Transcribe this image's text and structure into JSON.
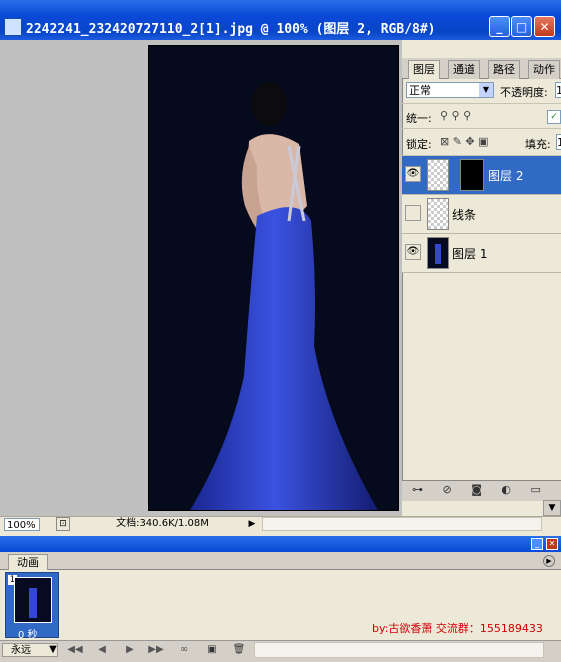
{
  "window": {
    "title": "2242241_232420727110_2[1].jpg @ 100% (图层 2, RGB/8#)",
    "min": "_",
    "max": "□",
    "close": "✕"
  },
  "status": {
    "zoom": "100%",
    "doc": "文档:340.6K/1.08M"
  },
  "layers_panel": {
    "tabs": [
      "图层",
      "通道",
      "路径",
      "动作"
    ],
    "blend_mode": "正常",
    "opacity_label": "不透明度:",
    "opacity_value": "1",
    "unify_label": "统一:",
    "lock_label": "锁定:",
    "fill_label": "填充:",
    "fill_value": "1",
    "layers": [
      {
        "name": "图层 2",
        "visible": true,
        "selected": true
      },
      {
        "name": "线条",
        "visible": false,
        "selected": false
      },
      {
        "name": "图层 1",
        "visible": true,
        "selected": false
      }
    ]
  },
  "animation": {
    "tab": "动画",
    "frame_number": "1",
    "frame_delay": "0 秒",
    "loop": "永远",
    "credit": "by:古欲香萧 交流群：155189433"
  },
  "colors": {
    "accent": "#316ac5",
    "dress": "#2a3fc9",
    "background": "#050a1c"
  }
}
